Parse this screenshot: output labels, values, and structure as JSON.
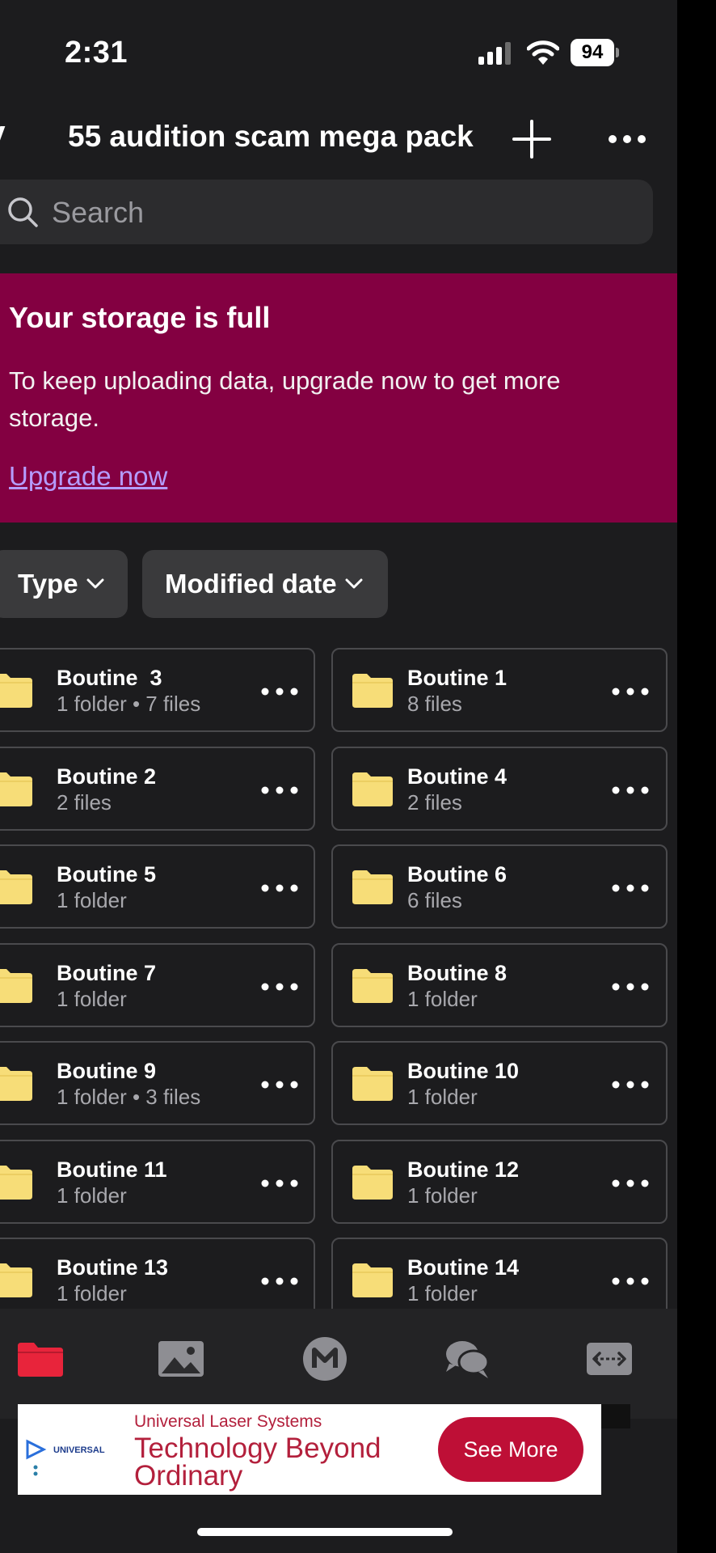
{
  "status_bar": {
    "time": "2:31",
    "battery": "94"
  },
  "header": {
    "title": "55 audition scam mega pack"
  },
  "search": {
    "placeholder": "Search"
  },
  "storage_banner": {
    "title": "Your storage is full",
    "message": "To keep uploading data, upgrade now to get more storage.",
    "link": "Upgrade now"
  },
  "filters": {
    "type_label": "Type",
    "date_label": "Modified date"
  },
  "folders": [
    {
      "name": "Boutine  3",
      "meta": "1 folder • 7 files"
    },
    {
      "name": "Boutine 1",
      "meta": "8 files"
    },
    {
      "name": "Boutine 2",
      "meta": "2 files"
    },
    {
      "name": "Boutine 4",
      "meta": "2 files"
    },
    {
      "name": "Boutine 5",
      "meta": "1 folder"
    },
    {
      "name": "Boutine 6",
      "meta": "6 files"
    },
    {
      "name": "Boutine 7",
      "meta": "1 folder"
    },
    {
      "name": "Boutine 8",
      "meta": "1 folder"
    },
    {
      "name": "Boutine 9",
      "meta": "1 folder • 3 files"
    },
    {
      "name": "Boutine 10",
      "meta": "1 folder"
    },
    {
      "name": "Boutine 11",
      "meta": "1 folder"
    },
    {
      "name": "Boutine 12",
      "meta": "1 folder"
    },
    {
      "name": "Boutine 13",
      "meta": "1 folder"
    },
    {
      "name": "Boutine 14",
      "meta": "1 folder"
    }
  ],
  "tab_bar": {
    "items": [
      {
        "icon": "folder-icon",
        "active": true
      },
      {
        "icon": "photos-icon",
        "active": false
      },
      {
        "icon": "mega-icon",
        "active": false
      },
      {
        "icon": "chat-icon",
        "active": false
      },
      {
        "icon": "transfers-icon",
        "active": false
      }
    ]
  },
  "ad": {
    "advertiser": "Universal Laser Systems",
    "headline": "Technology Beyond Ordinary",
    "cta": "See More",
    "logo_text": "UNIVERSAL"
  },
  "colors": {
    "background": "#1c1c1e",
    "banner": "#830041",
    "link": "#b59cff",
    "folder": "#f7dd78",
    "active_tab": "#e8243b",
    "ad_accent": "#be0f36"
  }
}
